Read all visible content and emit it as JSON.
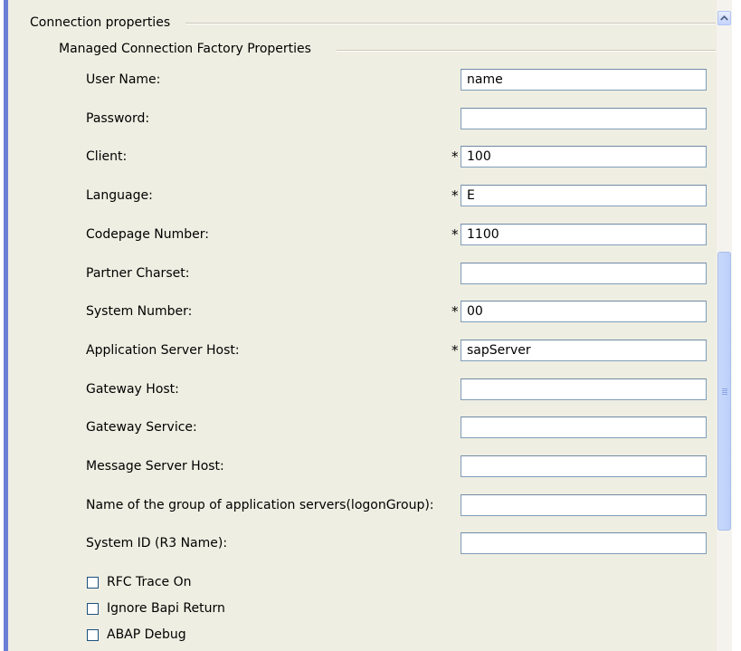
{
  "groups": {
    "outer_title": "Connection properties",
    "inner_title": "Managed Connection Factory Properties"
  },
  "fields": [
    {
      "label": "User Name:",
      "required": "",
      "value": "name"
    },
    {
      "label": "Password:",
      "required": "",
      "value": ""
    },
    {
      "label": "Client:",
      "required": "*",
      "value": "100"
    },
    {
      "label": "Language:",
      "required": "*",
      "value": "E"
    },
    {
      "label": "Codepage Number:",
      "required": "*",
      "value": "1100"
    },
    {
      "label": "Partner Charset:",
      "required": "",
      "value": ""
    },
    {
      "label": "System Number:",
      "required": "*",
      "value": "00"
    },
    {
      "label": "Application Server Host:",
      "required": "*",
      "value": "sapServer"
    },
    {
      "label": "Gateway Host:",
      "required": "",
      "value": ""
    },
    {
      "label": "Gateway Service:",
      "required": "",
      "value": ""
    },
    {
      "label": "Message Server Host:",
      "required": "",
      "value": ""
    },
    {
      "label": "Name of the group of application servers(logonGroup):",
      "required": "",
      "value": ""
    },
    {
      "label": "System ID (R3 Name):",
      "required": "",
      "value": ""
    }
  ],
  "checkboxes": [
    {
      "label": "RFC Trace On",
      "checked": false
    },
    {
      "label": "Ignore Bapi Return",
      "checked": false
    },
    {
      "label": "ABAP Debug",
      "checked": false
    }
  ],
  "icons": {
    "scroll_up": "chevron-up-icon",
    "scroll_grip": "grip-icon"
  },
  "colors": {
    "panel_bg": "#efeee2",
    "left_bar": "#6b7fd6",
    "field_border": "#7f9db9",
    "scrollbar_thumb": "#c1d3fb"
  }
}
